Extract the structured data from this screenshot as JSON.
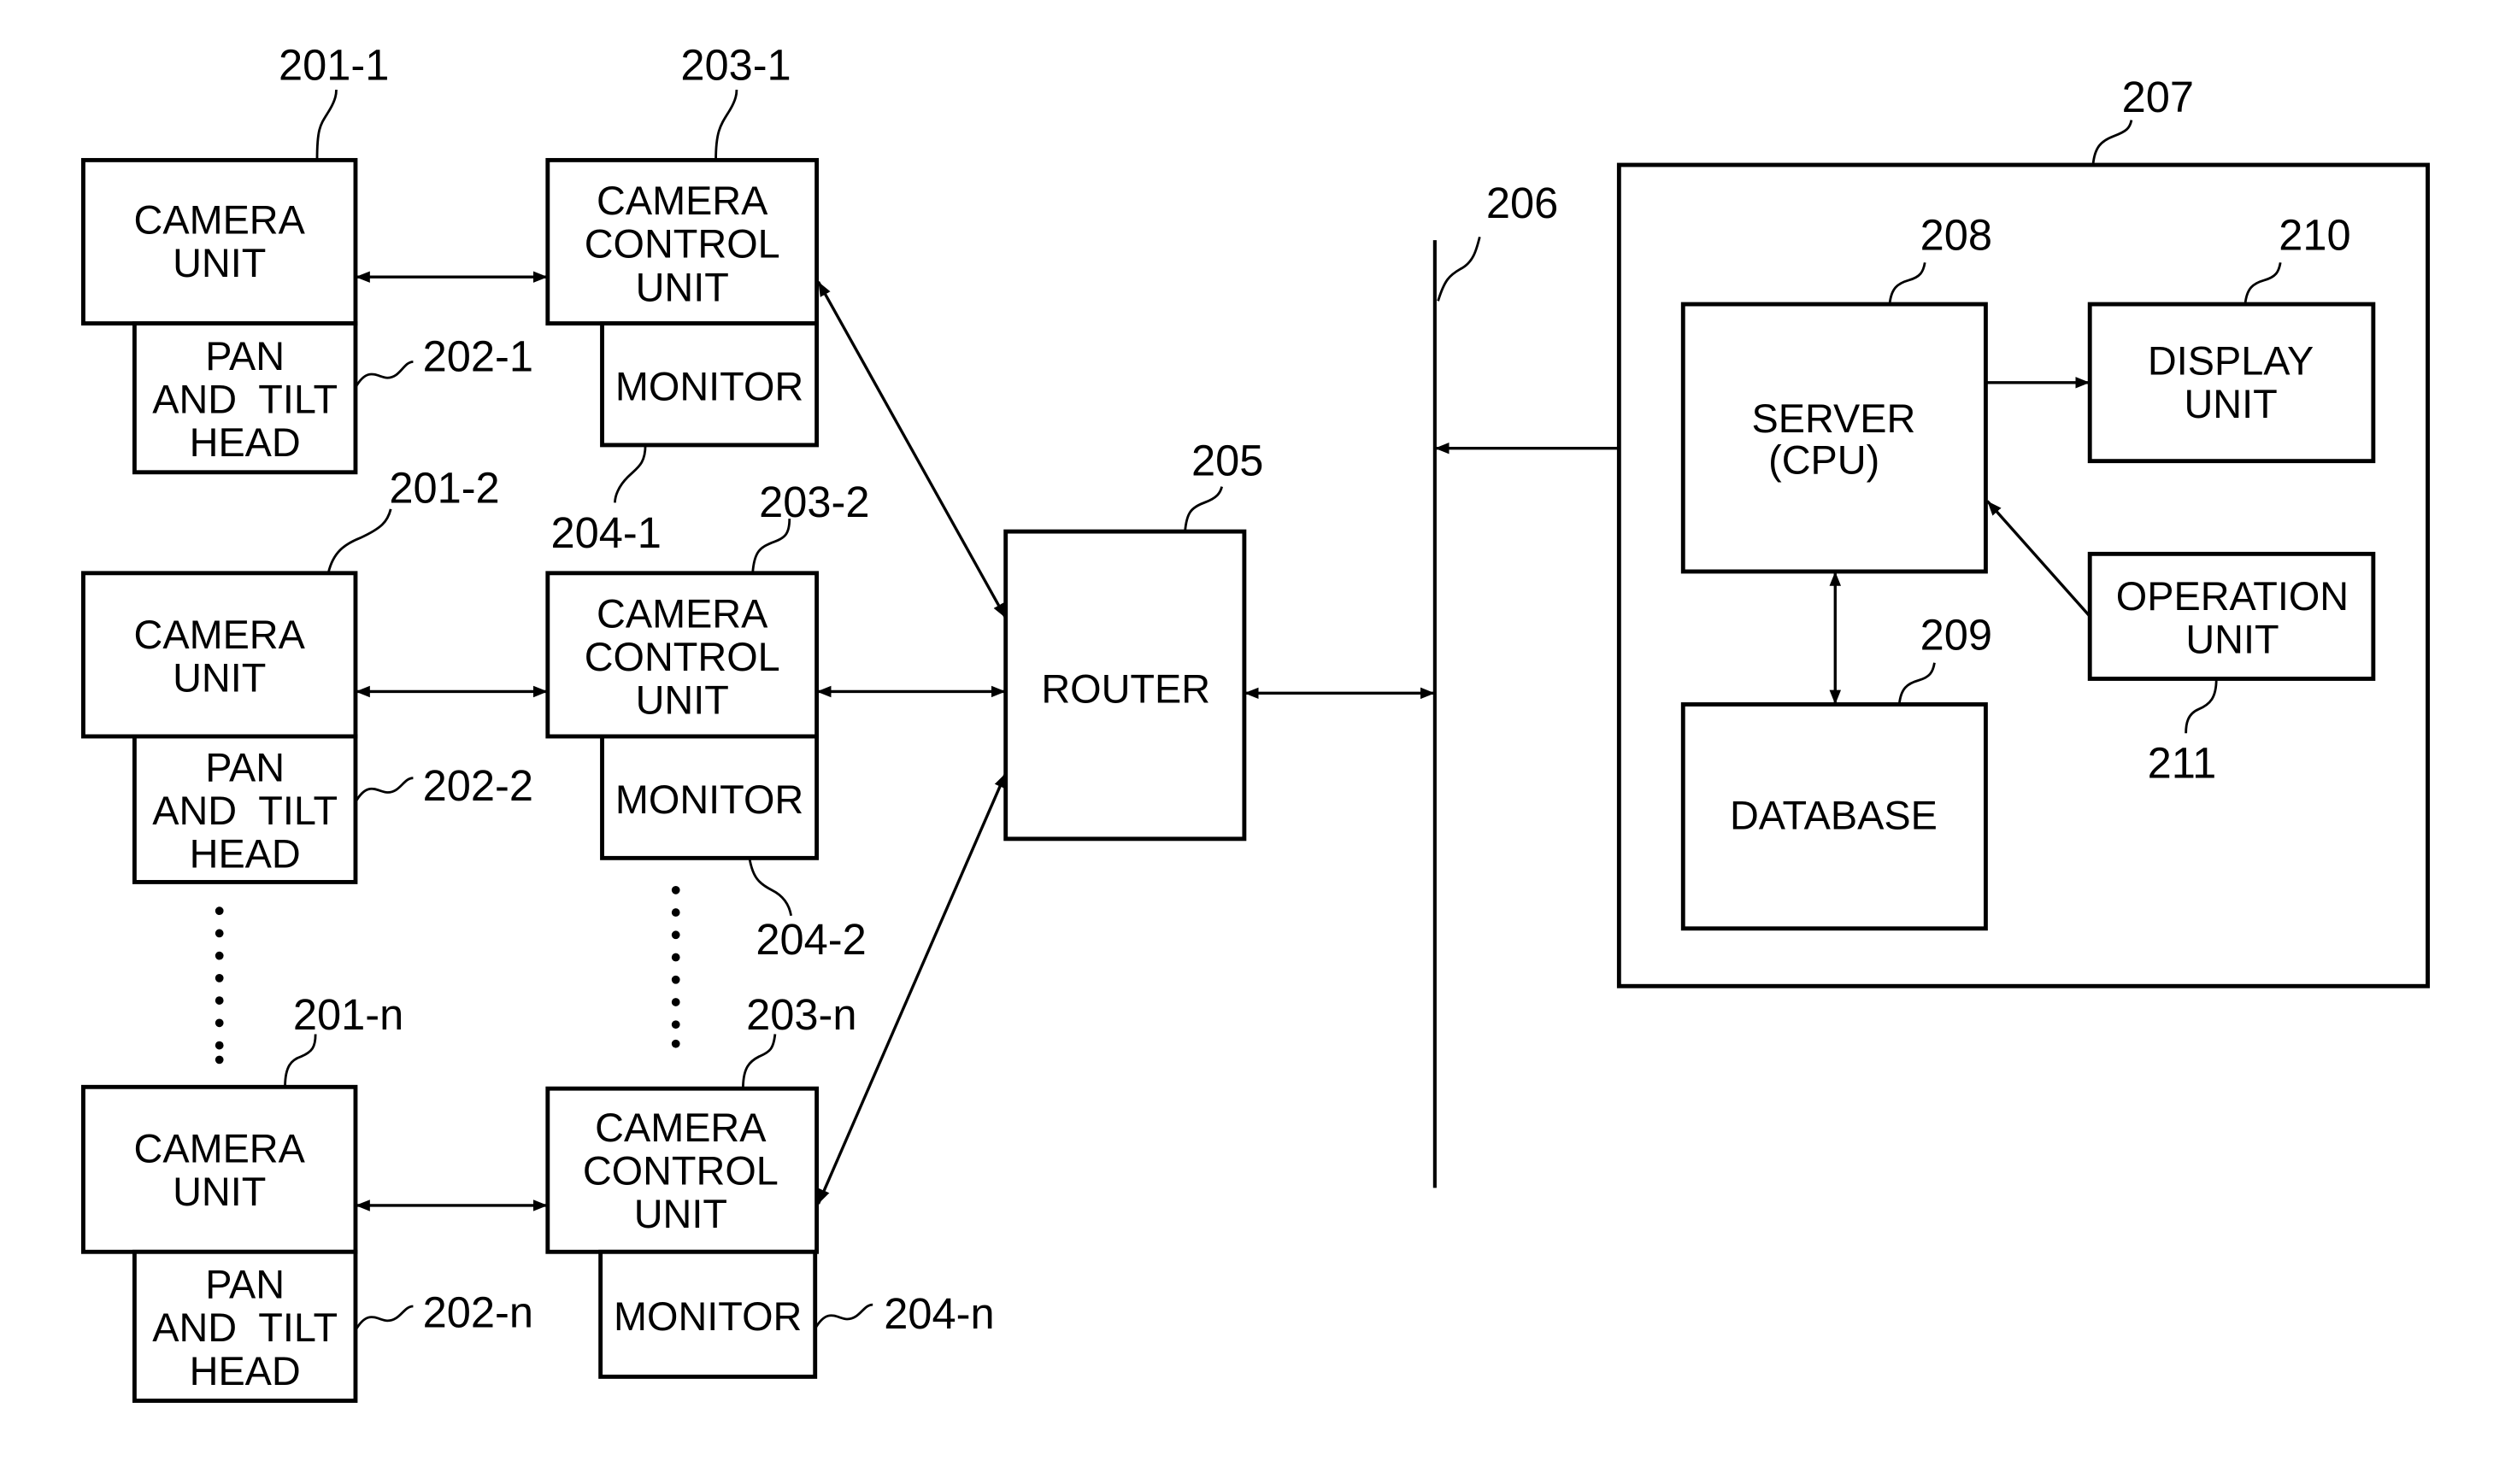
{
  "figure": {
    "camera_groups": [
      {
        "camera_unit": {
          "ref": "201-1",
          "lines": [
            "CAMERA",
            "UNIT"
          ]
        },
        "pan_tilt_head": {
          "ref": "202-1",
          "lines": [
            "PAN",
            "AND  TILT",
            "HEAD"
          ]
        },
        "camera_control_unit": {
          "ref": "203-1",
          "lines": [
            "CAMERA",
            "CONTROL",
            "UNIT"
          ]
        },
        "monitor": {
          "ref": "204-1",
          "lines": [
            "MONITOR"
          ]
        }
      },
      {
        "camera_unit": {
          "ref": "201-2",
          "lines": [
            "CAMERA",
            "UNIT"
          ]
        },
        "pan_tilt_head": {
          "ref": "202-2",
          "lines": [
            "PAN",
            "AND  TILT",
            "HEAD"
          ]
        },
        "camera_control_unit": {
          "ref": "203-2",
          "lines": [
            "CAMERA",
            "CONTROL",
            "UNIT"
          ]
        },
        "monitor": {
          "ref": "204-2",
          "lines": [
            "MONITOR"
          ]
        }
      },
      {
        "camera_unit": {
          "ref": "201-n",
          "lines": [
            "CAMERA",
            "UNIT"
          ]
        },
        "pan_tilt_head": {
          "ref": "202-n",
          "lines": [
            "PAN",
            "AND  TILT",
            "HEAD"
          ]
        },
        "camera_control_unit": {
          "ref": "203-n",
          "lines": [
            "CAMERA",
            "CONTROL",
            "UNIT"
          ]
        },
        "monitor": {
          "ref": "204-n",
          "lines": [
            "MONITOR"
          ]
        }
      }
    ],
    "router": {
      "ref": "205",
      "lines": [
        "ROUTER"
      ]
    },
    "network": {
      "ref": "206"
    },
    "system": {
      "ref": "207"
    },
    "server": {
      "ref": "208",
      "lines": [
        "SERVER",
        "(CPU)"
      ]
    },
    "database": {
      "ref": "209",
      "lines": [
        "DATABASE"
      ]
    },
    "display_unit": {
      "ref": "210",
      "lines": [
        "DISPLAY",
        "UNIT"
      ]
    },
    "operation_unit": {
      "ref": "211",
      "lines": [
        "OPERATION",
        "UNIT"
      ]
    }
  }
}
